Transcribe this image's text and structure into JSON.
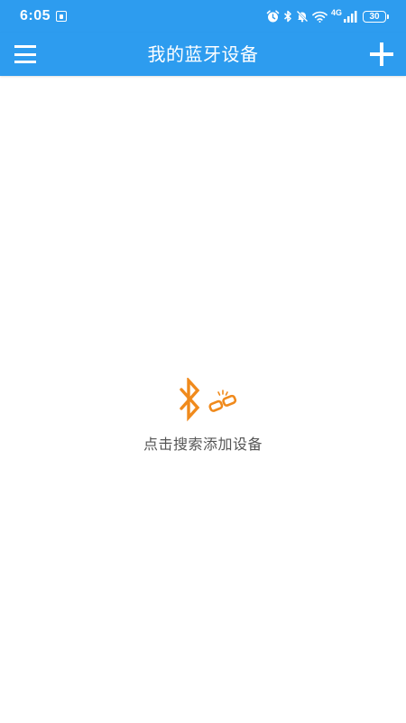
{
  "status_bar": {
    "time": "6:05",
    "network_label": "4G",
    "battery_level": "30",
    "icons": [
      "sim-icon",
      "alarm-icon",
      "bluetooth-icon",
      "mute-icon",
      "wifi-icon",
      "signal-icon",
      "battery-icon"
    ]
  },
  "app_bar": {
    "title": "我的蓝牙设备",
    "menu_icon": "menu-icon",
    "add_icon": "plus-icon"
  },
  "empty_state": {
    "icon": "bluetooth-disconnected-icon",
    "message": "点击搜索添加设备"
  },
  "colors": {
    "primary": "#2d9cef",
    "accent": "#f08a1c",
    "text_secondary": "#555555",
    "background": "#ffffff"
  }
}
